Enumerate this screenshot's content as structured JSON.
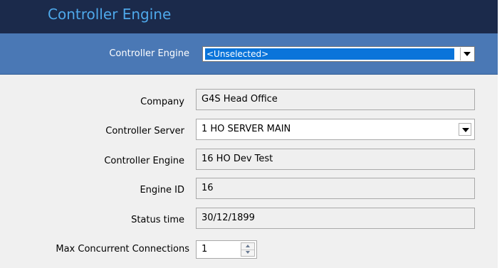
{
  "window": {
    "title": "Controller Engine"
  },
  "selector": {
    "label": "Controller Engine",
    "value": "<Unselected>"
  },
  "form": {
    "company_label": "Company",
    "company_value": "G4S Head Office",
    "server_label": "Controller Server",
    "server_value": "1 HO SERVER MAIN",
    "engine_label": "Controller Engine",
    "engine_value": "16 HO Dev Test",
    "engine_id_label": "Engine ID",
    "engine_id_value": "16",
    "status_time_label": "Status time",
    "status_time_value": "30/12/1899",
    "max_conn_label": "Max Concurrent Connections",
    "max_conn_value": "1"
  },
  "icons": {
    "dropdown": "chevron-down-icon",
    "spin_up": "spin-up-icon",
    "spin_down": "spin-down-icon"
  },
  "colors": {
    "title_bar": "#1b2a4b",
    "title_text": "#4ea8ea",
    "selector_bar": "#4a78b5",
    "selection_highlight": "#0a74da",
    "panel_background": "#f0f0f0"
  }
}
